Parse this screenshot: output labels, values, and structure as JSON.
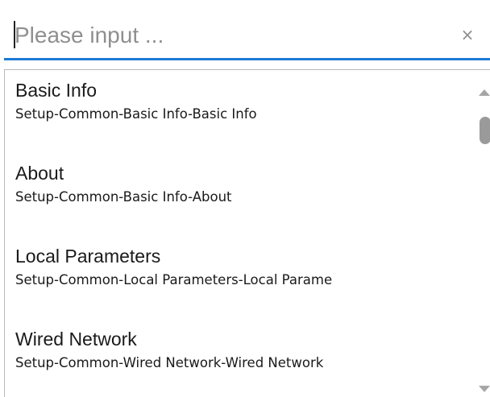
{
  "search": {
    "placeholder": "Please input ...",
    "value": "",
    "clear_icon": "close-icon",
    "clear_glyph": "×"
  },
  "colors": {
    "accent": "#1e7ad4",
    "text": "#1a1a1a",
    "placeholder": "#8f8f8f",
    "border": "#b9b9b9",
    "scroll_thumb": "#9a9a9a"
  },
  "results": [
    {
      "title": "Basic Info",
      "path": "Setup-Common-Basic Info-Basic Info"
    },
    {
      "title": "About",
      "path": "Setup-Common-Basic Info-About"
    },
    {
      "title": "Local Parameters",
      "path": "Setup-Common-Local Parameters-Local Parame"
    },
    {
      "title": "Wired Network",
      "path": "Setup-Common-Wired Network-Wired Network"
    }
  ],
  "scrollbar": {
    "up_icon": "scroll-up-arrow-icon",
    "down_icon": "scroll-down-arrow-icon"
  }
}
